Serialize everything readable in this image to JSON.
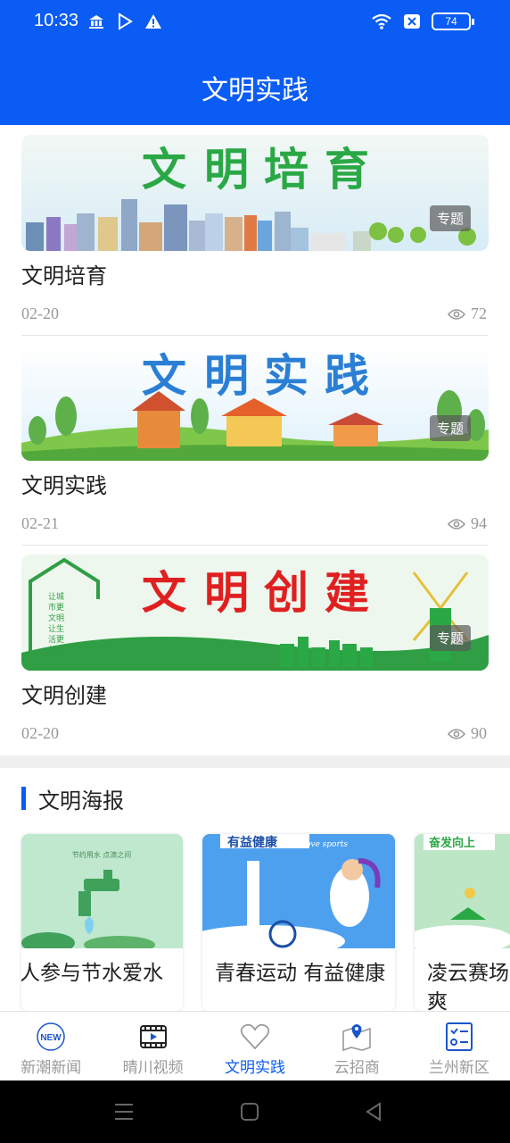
{
  "status_bar": {
    "time": "10:33",
    "battery": "74"
  },
  "header": {
    "title": "文明实践"
  },
  "articles": [
    {
      "banner_text": "文明培育",
      "badge": "专题",
      "title": "文明培育",
      "date": "02-20",
      "views": "72"
    },
    {
      "banner_text": "文明实践",
      "badge": "专题",
      "title": "文明实践",
      "date": "02-21",
      "views": "94"
    },
    {
      "banner_text": "文明创建",
      "badge": "专题",
      "title": "文明创建",
      "date": "02-20",
      "views": "90",
      "side_slogan": "让城市更文明 让生活更美好"
    }
  ],
  "posters_section": {
    "title": "文明海报",
    "items": [
      {
        "caption": "人参与节水爱水",
        "image_text": "节约用水 点滴之间"
      },
      {
        "caption": "青春运动 有益健康",
        "image_text": "有益健康",
        "image_subtext": "Love sports"
      },
      {
        "caption": "凌云赛场爽",
        "image_text": "奋发向上"
      }
    ]
  },
  "bottom_nav": [
    {
      "label": "新潮新闻",
      "icon": "new-badge-icon",
      "active": false
    },
    {
      "label": "晴川视频",
      "icon": "film-icon",
      "active": false
    },
    {
      "label": "文明实践",
      "icon": "heart-icon",
      "active": true
    },
    {
      "label": "云招商",
      "icon": "map-pin-icon",
      "active": false
    },
    {
      "label": "兰州新区",
      "icon": "checklist-icon",
      "active": false
    }
  ],
  "colors": {
    "brand_blue": "#0a5cf5",
    "green": "#2aa845",
    "red": "#e02020"
  }
}
